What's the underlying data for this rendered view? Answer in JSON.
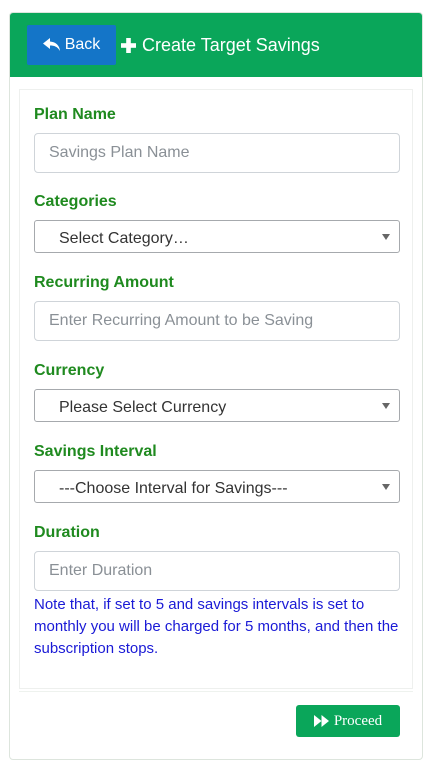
{
  "header": {
    "back_label": "Back",
    "title": "Create Target Savings",
    "back_icon": "reply-arrow-icon",
    "title_icon": "plus-icon",
    "color": "#0aa65a",
    "back_color": "#1475c8"
  },
  "form": {
    "plan_name": {
      "label": "Plan Name",
      "placeholder": "Savings Plan Name",
      "value": ""
    },
    "categories": {
      "label": "Categories",
      "selected": "Select Category…"
    },
    "recurring_amount": {
      "label": "Recurring Amount",
      "placeholder": "Enter Recurring Amount to be Saving",
      "value": ""
    },
    "currency": {
      "label": "Currency",
      "selected": "Please Select Currency"
    },
    "savings_interval": {
      "label": "Savings Interval",
      "selected": "---Choose Interval for Savings---"
    },
    "duration": {
      "label": "Duration",
      "placeholder": "Enter Duration",
      "value": ""
    },
    "note": "Note that, if set to 5 and savings intervals is set to monthly you will be charged for 5 months, and then the subscription stops."
  },
  "footer": {
    "proceed_label": "Proceed",
    "proceed_icon": "fast-forward-icon"
  },
  "colors": {
    "label": "#1f8a1f",
    "note": "#1a1ad6"
  }
}
